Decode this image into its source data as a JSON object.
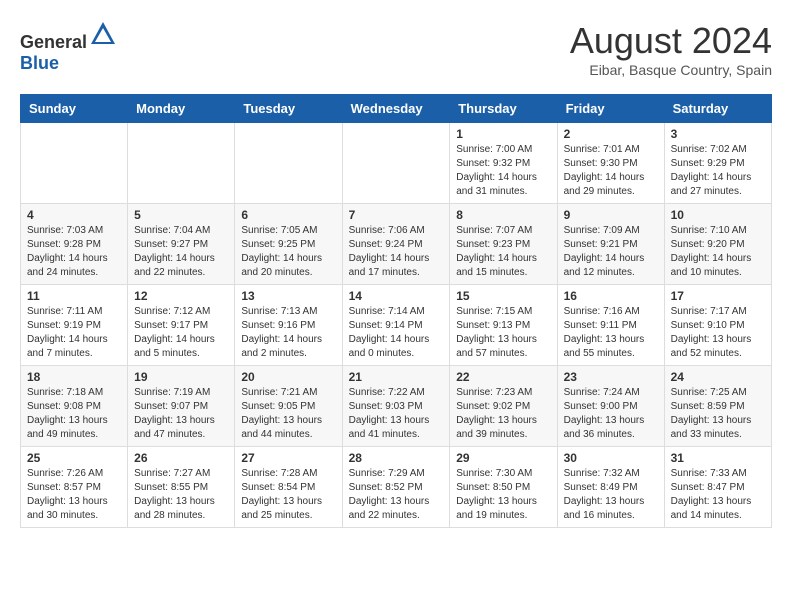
{
  "header": {
    "logo_general": "General",
    "logo_blue": "Blue",
    "month_year": "August 2024",
    "location": "Eibar, Basque Country, Spain"
  },
  "days_of_week": [
    "Sunday",
    "Monday",
    "Tuesday",
    "Wednesday",
    "Thursday",
    "Friday",
    "Saturday"
  ],
  "weeks": [
    {
      "days": [
        {
          "num": "",
          "info": ""
        },
        {
          "num": "",
          "info": ""
        },
        {
          "num": "",
          "info": ""
        },
        {
          "num": "",
          "info": ""
        },
        {
          "num": "1",
          "info": "Sunrise: 7:00 AM\nSunset: 9:32 PM\nDaylight: 14 hours\nand 31 minutes."
        },
        {
          "num": "2",
          "info": "Sunrise: 7:01 AM\nSunset: 9:30 PM\nDaylight: 14 hours\nand 29 minutes."
        },
        {
          "num": "3",
          "info": "Sunrise: 7:02 AM\nSunset: 9:29 PM\nDaylight: 14 hours\nand 27 minutes."
        }
      ]
    },
    {
      "days": [
        {
          "num": "4",
          "info": "Sunrise: 7:03 AM\nSunset: 9:28 PM\nDaylight: 14 hours\nand 24 minutes."
        },
        {
          "num": "5",
          "info": "Sunrise: 7:04 AM\nSunset: 9:27 PM\nDaylight: 14 hours\nand 22 minutes."
        },
        {
          "num": "6",
          "info": "Sunrise: 7:05 AM\nSunset: 9:25 PM\nDaylight: 14 hours\nand 20 minutes."
        },
        {
          "num": "7",
          "info": "Sunrise: 7:06 AM\nSunset: 9:24 PM\nDaylight: 14 hours\nand 17 minutes."
        },
        {
          "num": "8",
          "info": "Sunrise: 7:07 AM\nSunset: 9:23 PM\nDaylight: 14 hours\nand 15 minutes."
        },
        {
          "num": "9",
          "info": "Sunrise: 7:09 AM\nSunset: 9:21 PM\nDaylight: 14 hours\nand 12 minutes."
        },
        {
          "num": "10",
          "info": "Sunrise: 7:10 AM\nSunset: 9:20 PM\nDaylight: 14 hours\nand 10 minutes."
        }
      ]
    },
    {
      "days": [
        {
          "num": "11",
          "info": "Sunrise: 7:11 AM\nSunset: 9:19 PM\nDaylight: 14 hours\nand 7 minutes."
        },
        {
          "num": "12",
          "info": "Sunrise: 7:12 AM\nSunset: 9:17 PM\nDaylight: 14 hours\nand 5 minutes."
        },
        {
          "num": "13",
          "info": "Sunrise: 7:13 AM\nSunset: 9:16 PM\nDaylight: 14 hours\nand 2 minutes."
        },
        {
          "num": "14",
          "info": "Sunrise: 7:14 AM\nSunset: 9:14 PM\nDaylight: 14 hours\nand 0 minutes."
        },
        {
          "num": "15",
          "info": "Sunrise: 7:15 AM\nSunset: 9:13 PM\nDaylight: 13 hours\nand 57 minutes."
        },
        {
          "num": "16",
          "info": "Sunrise: 7:16 AM\nSunset: 9:11 PM\nDaylight: 13 hours\nand 55 minutes."
        },
        {
          "num": "17",
          "info": "Sunrise: 7:17 AM\nSunset: 9:10 PM\nDaylight: 13 hours\nand 52 minutes."
        }
      ]
    },
    {
      "days": [
        {
          "num": "18",
          "info": "Sunrise: 7:18 AM\nSunset: 9:08 PM\nDaylight: 13 hours\nand 49 minutes."
        },
        {
          "num": "19",
          "info": "Sunrise: 7:19 AM\nSunset: 9:07 PM\nDaylight: 13 hours\nand 47 minutes."
        },
        {
          "num": "20",
          "info": "Sunrise: 7:21 AM\nSunset: 9:05 PM\nDaylight: 13 hours\nand 44 minutes."
        },
        {
          "num": "21",
          "info": "Sunrise: 7:22 AM\nSunset: 9:03 PM\nDaylight: 13 hours\nand 41 minutes."
        },
        {
          "num": "22",
          "info": "Sunrise: 7:23 AM\nSunset: 9:02 PM\nDaylight: 13 hours\nand 39 minutes."
        },
        {
          "num": "23",
          "info": "Sunrise: 7:24 AM\nSunset: 9:00 PM\nDaylight: 13 hours\nand 36 minutes."
        },
        {
          "num": "24",
          "info": "Sunrise: 7:25 AM\nSunset: 8:59 PM\nDaylight: 13 hours\nand 33 minutes."
        }
      ]
    },
    {
      "days": [
        {
          "num": "25",
          "info": "Sunrise: 7:26 AM\nSunset: 8:57 PM\nDaylight: 13 hours\nand 30 minutes."
        },
        {
          "num": "26",
          "info": "Sunrise: 7:27 AM\nSunset: 8:55 PM\nDaylight: 13 hours\nand 28 minutes."
        },
        {
          "num": "27",
          "info": "Sunrise: 7:28 AM\nSunset: 8:54 PM\nDaylight: 13 hours\nand 25 minutes."
        },
        {
          "num": "28",
          "info": "Sunrise: 7:29 AM\nSunset: 8:52 PM\nDaylight: 13 hours\nand 22 minutes."
        },
        {
          "num": "29",
          "info": "Sunrise: 7:30 AM\nSunset: 8:50 PM\nDaylight: 13 hours\nand 19 minutes."
        },
        {
          "num": "30",
          "info": "Sunrise: 7:32 AM\nSunset: 8:49 PM\nDaylight: 13 hours\nand 16 minutes."
        },
        {
          "num": "31",
          "info": "Sunrise: 7:33 AM\nSunset: 8:47 PM\nDaylight: 13 hours\nand 14 minutes."
        }
      ]
    }
  ]
}
